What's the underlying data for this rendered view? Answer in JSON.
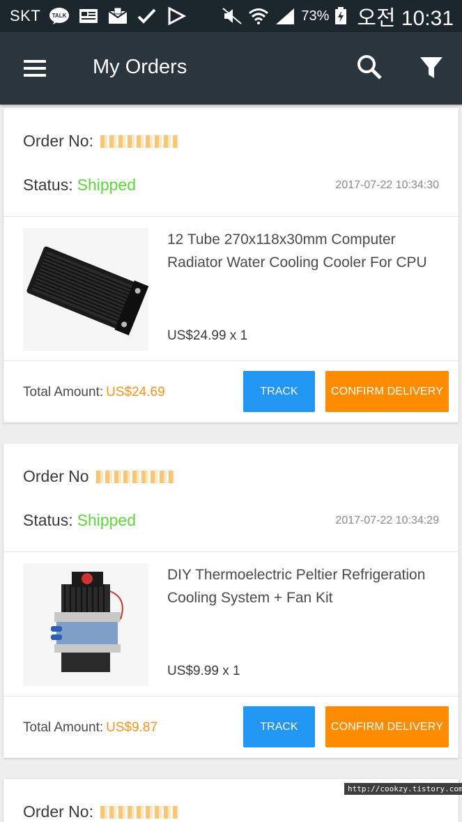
{
  "status_bar": {
    "carrier": "SKT",
    "battery": "73%",
    "time": "오전 10:31"
  },
  "app_bar": {
    "title": "My Orders",
    "icons": [
      "menu-icon",
      "search-icon",
      "filter-icon"
    ]
  },
  "colors": {
    "status_bar": "#1b262d",
    "app_bar": "#2b353d",
    "shipped": "#5dd63c",
    "amount": "#f7941d",
    "track_button": "#2196f3",
    "confirm_button": "#ff8c00"
  },
  "labels": {
    "order_no": "Order No:",
    "order_no_cut": "Order No",
    "status": "Status:",
    "total_amount": "Total Amount:",
    "track": "TRACK",
    "confirm_delivery": "CONFIRM DELIVERY"
  },
  "orders": [
    {
      "status": "Shipped",
      "date": "2017-07-22 10:34:30",
      "product_title": "12 Tube 270x118x30mm Computer Radiator Water Cooling Cooler For CPU",
      "price": "US$24.99 x 1",
      "total": "US$24.69",
      "image_icon": "radiator-image"
    },
    {
      "status": "Shipped",
      "date": "2017-07-22 10:34:29",
      "product_title": "DIY Thermoelectric Peltier Refrigeration Cooling System + Fan Kit",
      "price": "US$9.99 x 1",
      "total": "US$9.87",
      "image_icon": "peltier-kit-image"
    }
  ],
  "watermark": "http://cookzy.tistory.com"
}
